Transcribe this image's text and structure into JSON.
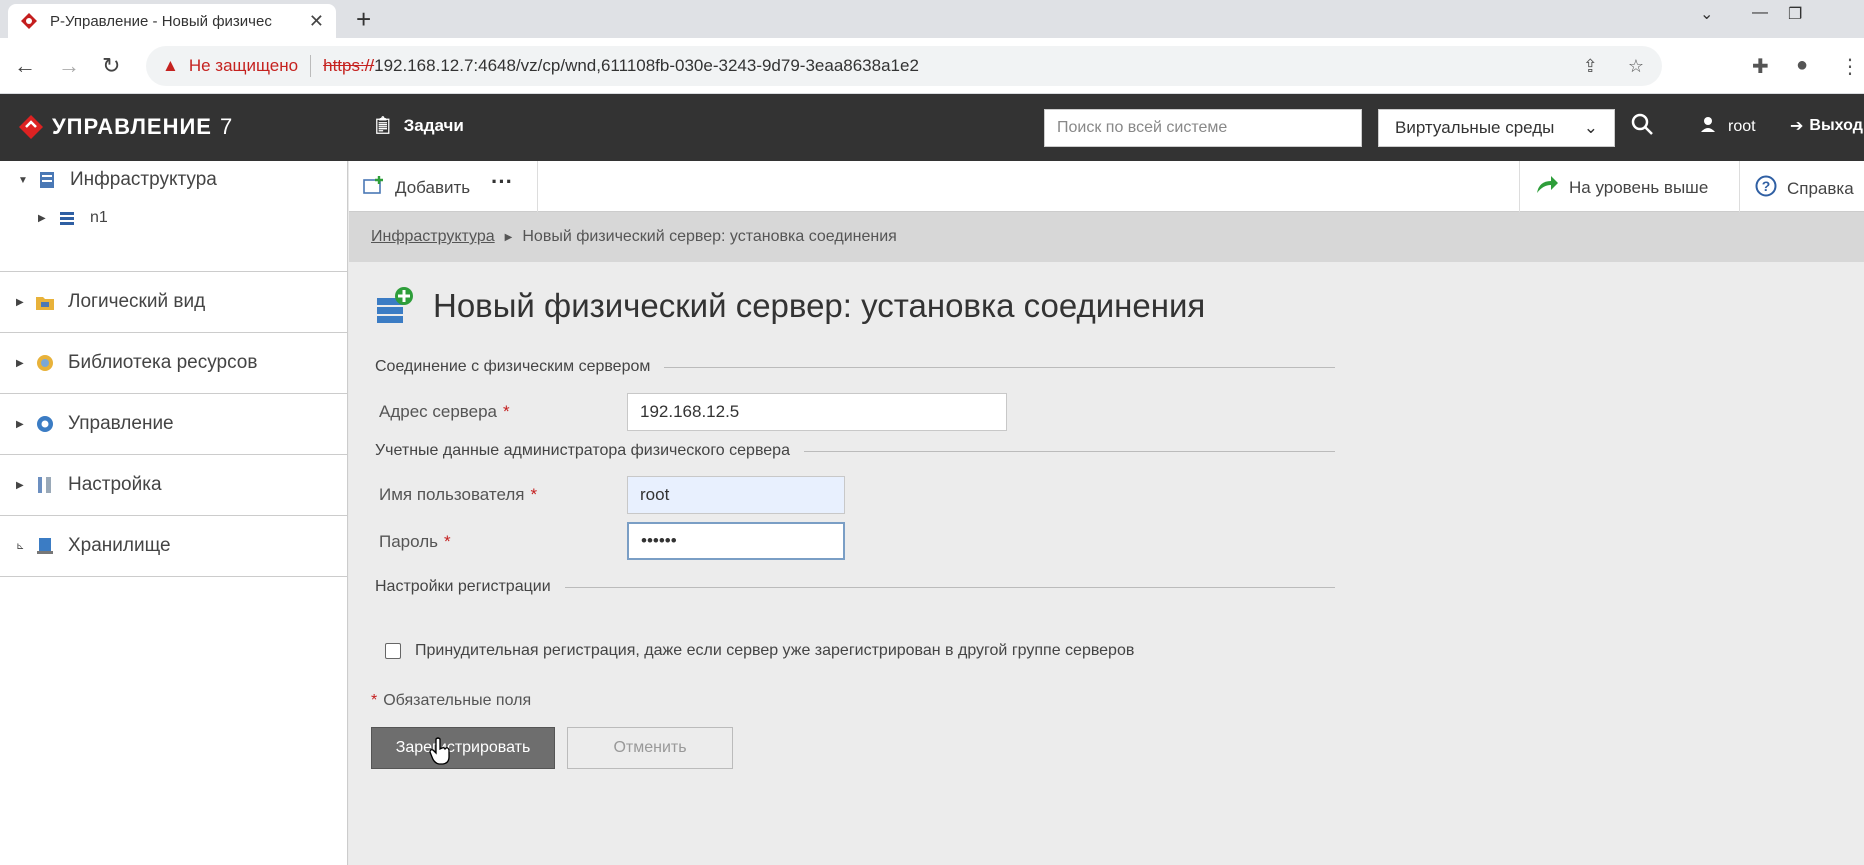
{
  "browser": {
    "tab_title": "Р-Управление - Новый физичес",
    "not_secure": "Не защищено",
    "url_scheme": "https://",
    "url_rest": "192.168.12.7:4648/vz/cp/wnd,611108fb-030e-3243-9d79-3eaa8638a1e2"
  },
  "header": {
    "logo": "УПРАВЛЕНИЕ",
    "logo_num": "7",
    "tasks": "Задачи",
    "search_placeholder": "Поиск по всей системе",
    "scope_select": "Виртуальные среды",
    "user": "root",
    "logout": "Выход"
  },
  "sidebar": {
    "root": "Инфраструктура",
    "child": "n1",
    "items": [
      "Логический вид",
      "Библиотека ресурсов",
      "Управление",
      "Настройка",
      "Хранилище"
    ]
  },
  "toolbar": {
    "add": "Добавить",
    "more": "···",
    "up": "На уровень выше",
    "help": "Справка"
  },
  "breadcrumb": {
    "link": "Инфраструктура",
    "current": "Новый физический сервер: установка соединения"
  },
  "page": {
    "title": "Новый физический сервер: установка соединения",
    "section_connection": "Соединение с физическим сервером",
    "label_address": "Адрес сервера",
    "value_address": "192.168.12.5",
    "section_credentials": "Учетные данные администратора физического сервера",
    "label_user": "Имя пользователя",
    "value_user": "root",
    "label_password": "Пароль",
    "value_password": "••••••",
    "section_registration": "Настройки регистрации",
    "force_checkbox": "Принудительная регистрация, даже если сервер уже зарегистрирован в другой группе серверов",
    "required_note": "Обязательные поля",
    "required_mark": "*",
    "register_button": "Зарегистрировать",
    "cancel_button": "Отменить"
  }
}
